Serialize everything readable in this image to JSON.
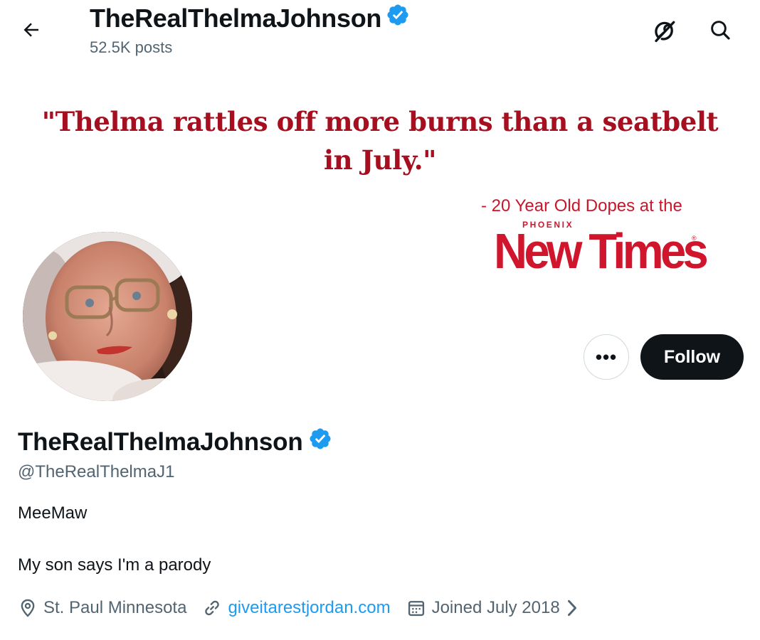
{
  "header": {
    "title": "TheRealThelmaJohnson",
    "post_count": "52.5K posts",
    "back_icon": "arrow-left-icon",
    "grok_icon": "grok-icon",
    "search_icon": "search-icon"
  },
  "banner": {
    "quote_line1": "\"Thelma rattles off more burns than a seatbelt",
    "quote_line2": "in July.\"",
    "attribution": "- 20 Year Old Dopes at the",
    "logo_small": "PHOENIX",
    "logo_main": "New Times",
    "logo_reg": "®"
  },
  "actions": {
    "more_label": "•••",
    "follow_label": "Follow"
  },
  "profile": {
    "display_name": "TheRealThelmaJohnson",
    "verified": true,
    "handle": "@TheRealThelmaJ1",
    "bio_line1": "MeeMaw",
    "bio_line2": "My son says I'm a parody",
    "location": "St. Paul Minnesota",
    "website": "giveitarestjordan.com",
    "joined": "Joined July 2018"
  },
  "colors": {
    "text": "#0f1419",
    "secondary": "#536471",
    "link": "#1d9bf0",
    "verified": "#1d9bf0",
    "banner_red": "#a50f1f",
    "follow_bg": "#0f1419"
  }
}
